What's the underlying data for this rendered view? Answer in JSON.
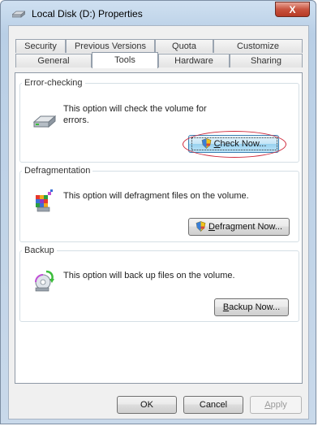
{
  "window": {
    "title": "Local Disk (D:) Properties",
    "close_label": "X"
  },
  "tabs": {
    "row1": [
      {
        "label": "Security"
      },
      {
        "label": "Previous Versions"
      },
      {
        "label": "Quota"
      },
      {
        "label": "Customize"
      }
    ],
    "row2": [
      {
        "label": "General"
      },
      {
        "label": "Tools",
        "active": true
      },
      {
        "label": "Hardware"
      },
      {
        "label": "Sharing"
      }
    ]
  },
  "groups": {
    "error_checking": {
      "title": "Error-checking",
      "description": "This option will check the volume for errors.",
      "button": {
        "mnemonic": "C",
        "rest": "heck Now...",
        "icon": "shield-icon"
      }
    },
    "defragmentation": {
      "title": "Defragmentation",
      "description": "This option will defragment files on the volume.",
      "button": {
        "mnemonic": "D",
        "rest": "efragment Now...",
        "icon": "shield-icon"
      }
    },
    "backup": {
      "title": "Backup",
      "description": "This option will back up files on the volume.",
      "button": {
        "mnemonic": "B",
        "rest": "ackup Now..."
      }
    }
  },
  "footer": {
    "ok_label": "OK",
    "cancel_label": "Cancel",
    "apply_mnemonic": "A",
    "apply_rest": "pply"
  },
  "colors": {
    "title_bar": "#cfe0f1",
    "close_button": "#c8533f",
    "highlight_ellipse": "#cf2b3d",
    "focused_button": "#c4e5f6"
  }
}
